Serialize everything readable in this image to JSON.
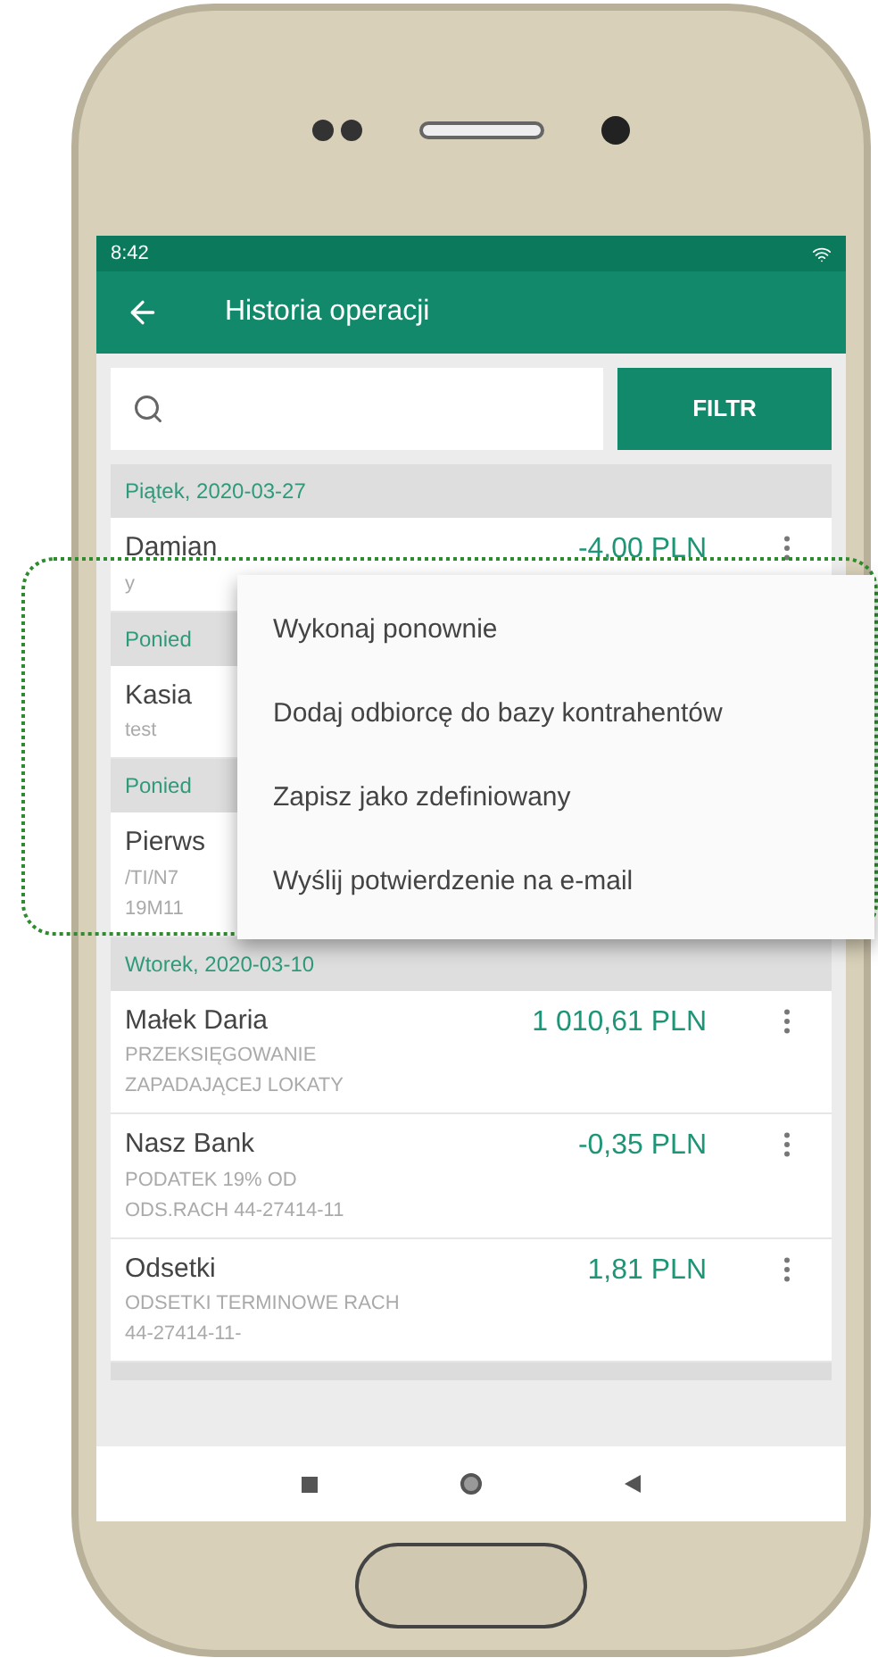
{
  "status_bar": {
    "time": "8:42"
  },
  "app_bar": {
    "title": "Historia operacji"
  },
  "search": {
    "button": "FILTR"
  },
  "groups": [
    {
      "date": "Piątek, 2020-03-27",
      "transactions": [
        {
          "name": "Damian",
          "details": [
            "y"
          ],
          "amount": "-4,00 PLN"
        }
      ]
    },
    {
      "date": "Ponied",
      "transactions": [
        {
          "name": "Kasia",
          "details": [
            "test"
          ]
        }
      ]
    },
    {
      "date": "Ponied",
      "transactions": [
        {
          "name": "Pierws",
          "details": [
            "/TI/N7",
            "19M11"
          ]
        }
      ]
    },
    {
      "date": "Wtorek, 2020-03-10",
      "transactions": [
        {
          "name": "Małek Daria",
          "details": [
            "PRZEKSIĘGOWANIE",
            "ZAPADAJĄCEJ LOKATY"
          ],
          "amount": "1 010,61 PLN"
        },
        {
          "name": "Nasz Bank",
          "details": [
            "PODATEK 19% OD",
            "ODS.RACH 44-27414-11"
          ],
          "amount": "-0,35 PLN"
        },
        {
          "name": "Odsetki",
          "details": [
            "ODSETKI TERMINOWE RACH",
            "44-27414-11-"
          ],
          "amount": "1,81 PLN"
        }
      ]
    }
  ],
  "context_menu": {
    "items": [
      "Wykonaj ponownie",
      "Dodaj odbiorcę do bazy kontrahentów",
      "Zapisz jako zdefiniowany",
      "Wyślij potwierdzenie na e-mail"
    ]
  }
}
